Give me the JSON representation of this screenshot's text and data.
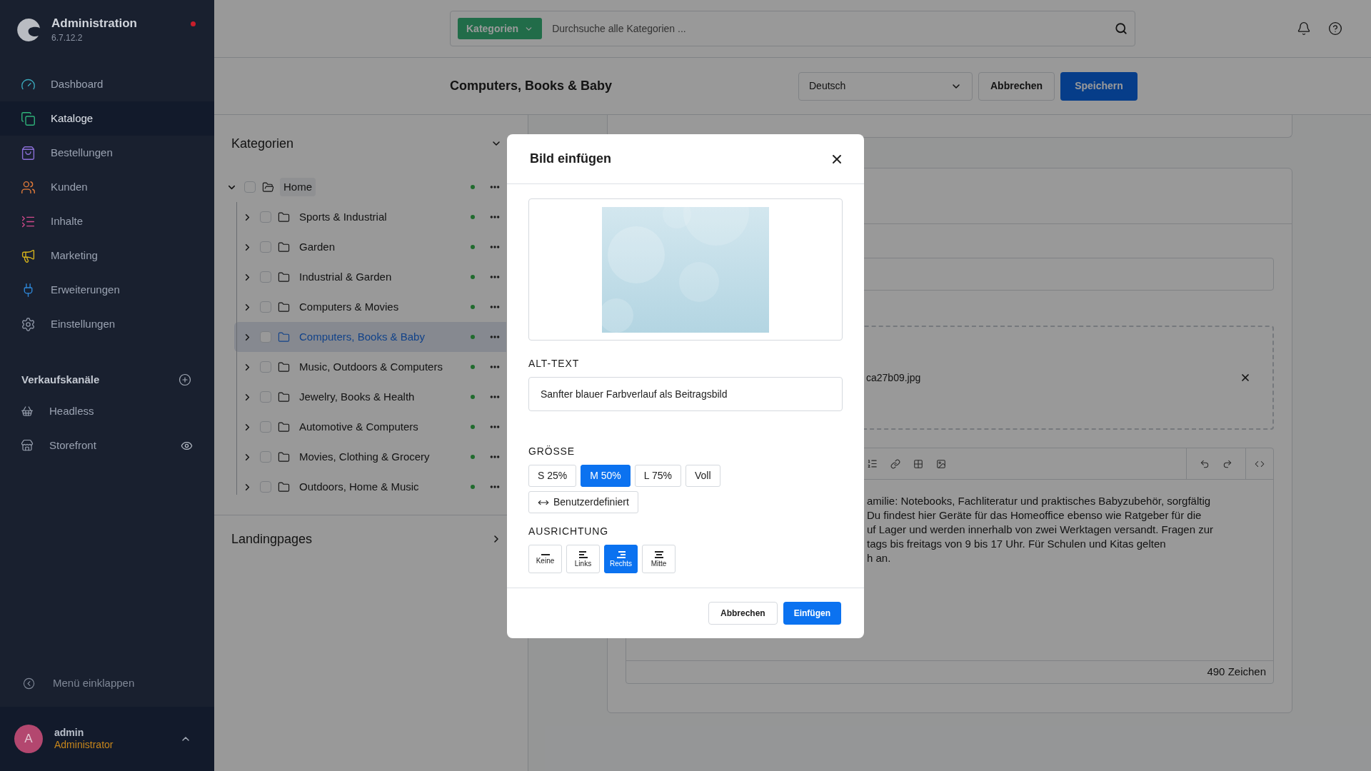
{
  "sidebar": {
    "brand": {
      "title": "Administration",
      "version": "6.7.12.2",
      "notification": true
    },
    "nav": [
      {
        "label": "Dashboard",
        "selected": false
      },
      {
        "label": "Kataloge",
        "selected": true
      },
      {
        "label": "Bestellungen",
        "selected": false
      },
      {
        "label": "Kunden",
        "selected": false
      },
      {
        "label": "Inhalte",
        "selected": false
      },
      {
        "label": "Marketing",
        "selected": false
      },
      {
        "label": "Erweiterungen",
        "selected": false
      },
      {
        "label": "Einstellungen",
        "selected": false
      }
    ],
    "sales_channels_title": "Verkaufskanäle",
    "sales_channels": [
      {
        "label": "Headless",
        "kind": "headless"
      },
      {
        "label": "Storefront",
        "kind": "storefront"
      }
    ],
    "collapse_label": "Menü einklappen",
    "user": {
      "initial": "A",
      "name": "admin",
      "role": "Administrator"
    }
  },
  "topbar": {
    "search_scope": "Kategorien",
    "search_placeholder": "Durchsuche alle Kategorien ..."
  },
  "header": {
    "title": "Computers, Books & Baby",
    "language": "Deutsch",
    "cancel": "Abbrechen",
    "save": "Speichern"
  },
  "categories": {
    "title": "Kategorien",
    "tree": [
      {
        "label": "Home",
        "expanded": true,
        "selected": false,
        "active": true,
        "checked": false,
        "children": [
          {
            "label": "Sports & Industrial",
            "expanded": false,
            "selected": false,
            "active": true,
            "checked": false
          },
          {
            "label": "Garden",
            "expanded": false,
            "selected": false,
            "active": true,
            "checked": false
          },
          {
            "label": "Industrial & Garden",
            "expanded": false,
            "selected": false,
            "active": true,
            "checked": false
          },
          {
            "label": "Computers & Movies",
            "expanded": false,
            "selected": false,
            "active": true,
            "checked": false
          },
          {
            "label": "Computers, Books & Baby",
            "expanded": false,
            "selected": true,
            "active": true,
            "checked": false
          },
          {
            "label": "Music, Outdoors & Computers",
            "expanded": false,
            "selected": false,
            "active": true,
            "checked": false
          },
          {
            "label": "Jewelry, Books & Health",
            "expanded": false,
            "selected": false,
            "active": true,
            "checked": false
          },
          {
            "label": "Automotive & Computers",
            "expanded": false,
            "selected": false,
            "active": true,
            "checked": false
          },
          {
            "label": "Movies, Clothing & Grocery",
            "expanded": false,
            "selected": false,
            "active": true,
            "checked": false
          },
          {
            "label": "Outdoors, Home & Music",
            "expanded": false,
            "selected": false,
            "active": true,
            "checked": false
          }
        ]
      }
    ],
    "landingpages_title": "Landingpages"
  },
  "content": {
    "file_name": "ca27b09.jpg",
    "editor_lines": [
      "amilie: Notebooks, Fachliteratur und praktisches Babyzubehör, sorgfältig",
      "Du findest hier Geräte für das Homeoffice ebenso wie Ratgeber für die",
      "uf Lager und werden innerhalb von zwei Werktagen versandt. Fragen zur",
      "tags bis freitags von 9 bis 17 Uhr. Für Schulen und Kitas gelten",
      "h an."
    ],
    "char_count": "490 Zeichen"
  },
  "dialog": {
    "title": "Bild einfügen",
    "alt_label": "ALT-TEXT",
    "alt_value": "Sanfter blauer Farbverlauf als Beitragsbild",
    "size_label": "GRÖSSE",
    "sizes": [
      {
        "label": "S 25%",
        "selected": false
      },
      {
        "label": "M 50%",
        "selected": true
      },
      {
        "label": "L 75%",
        "selected": false
      },
      {
        "label": "Voll",
        "selected": false
      }
    ],
    "custom_size": "Benutzerdefiniert",
    "align_label": "AUSRICHTUNG",
    "alignments": [
      {
        "label": "Keine",
        "kind": "none",
        "selected": false
      },
      {
        "label": "Links",
        "kind": "left",
        "selected": false
      },
      {
        "label": "Rechts",
        "kind": "right",
        "selected": true
      },
      {
        "label": "Mitte",
        "kind": "center",
        "selected": false
      }
    ],
    "cancel": "Abbrechen",
    "insert": "Einfügen"
  }
}
